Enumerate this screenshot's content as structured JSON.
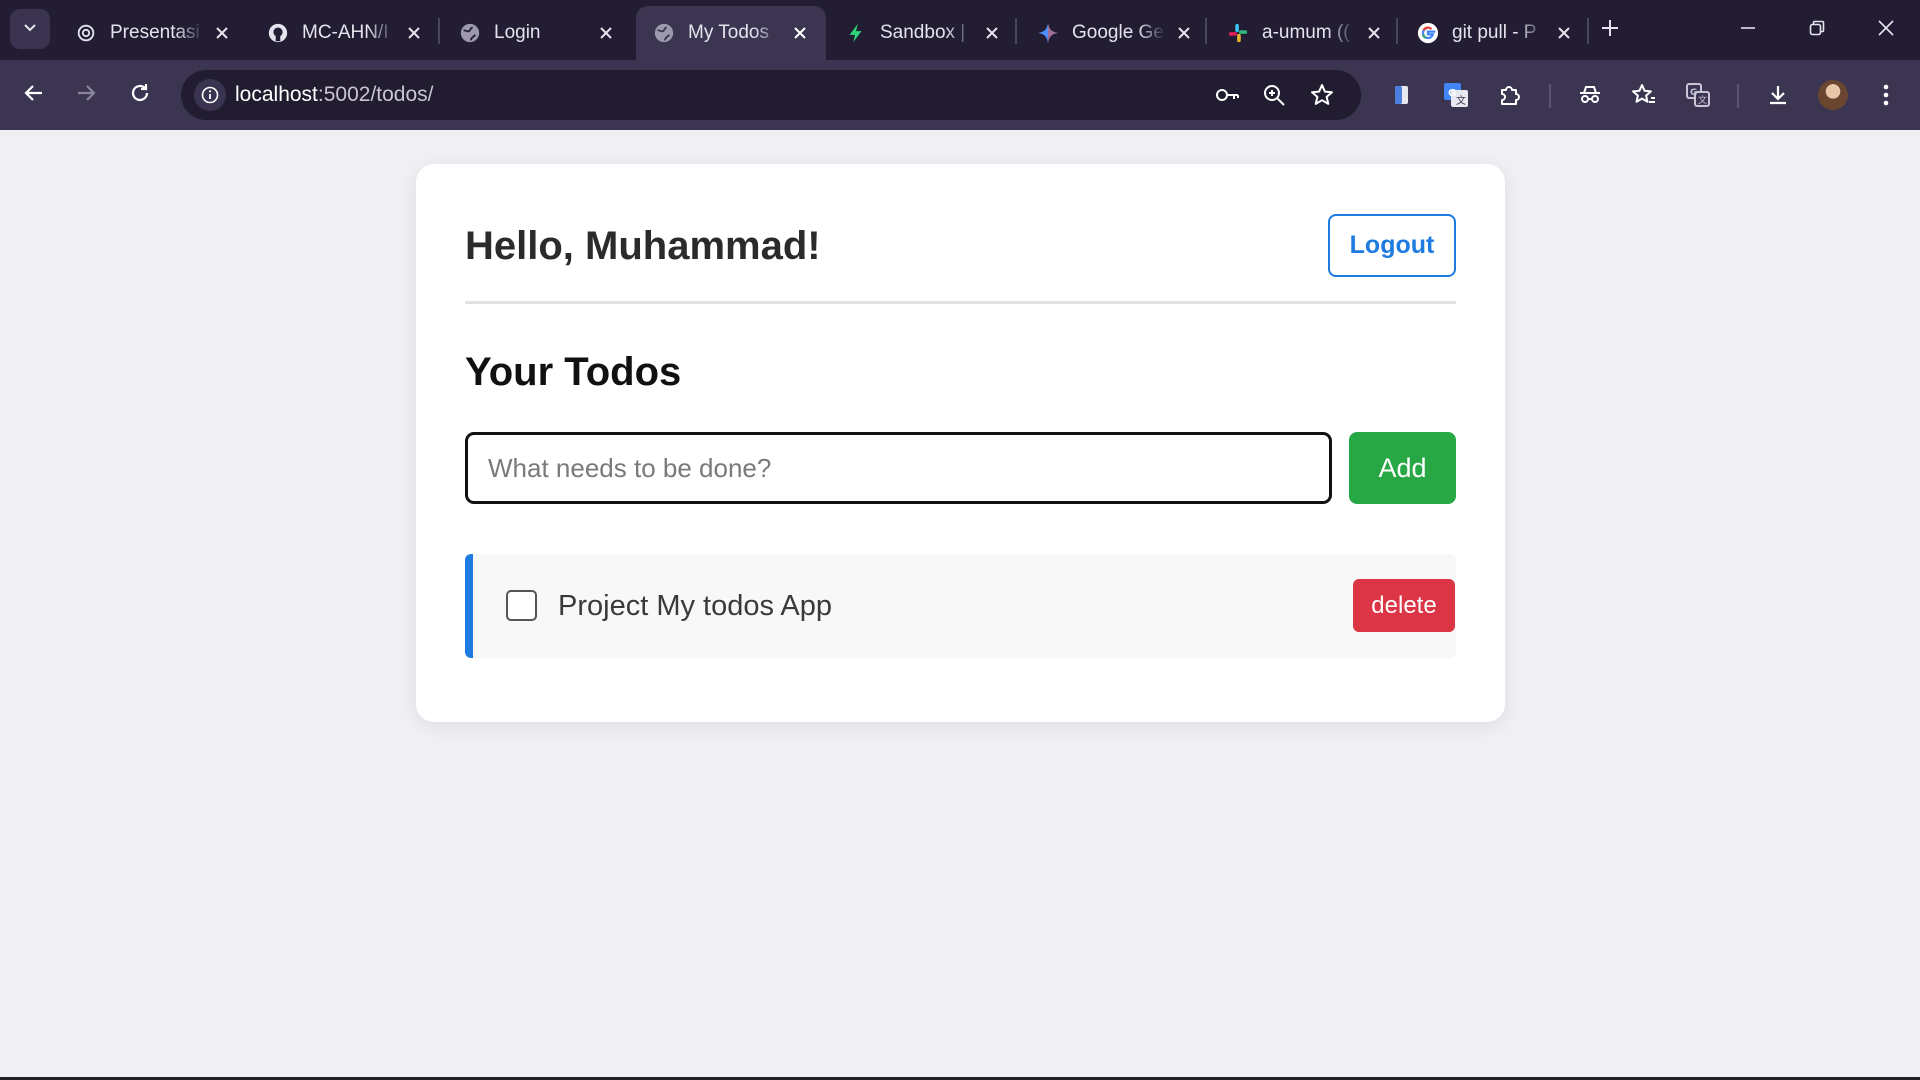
{
  "browser": {
    "tabs": [
      {
        "title": "Presentasi",
        "icon": "openai-icon"
      },
      {
        "title": "MC-AHN/I",
        "icon": "github-icon"
      },
      {
        "title": "Login",
        "icon": "globe-icon"
      },
      {
        "title": "My Todos",
        "icon": "globe-icon",
        "active": true
      },
      {
        "title": "Sandbox | ",
        "icon": "bolt-icon"
      },
      {
        "title": "Google Ge",
        "icon": "gemini-icon"
      },
      {
        "title": "a-umum ((",
        "icon": "slack-icon"
      },
      {
        "title": "git pull - P",
        "icon": "google-icon"
      }
    ],
    "url_host": "localhost",
    "url_path": ":5002/todos/",
    "colors": {
      "tabstrip": "#221d32",
      "toolbar": "#3b3552",
      "omnibox": "#211c30"
    }
  },
  "page": {
    "greeting": "Hello, Muhammad!",
    "logout_label": "Logout",
    "section_title": "Your Todos",
    "input_placeholder": "What needs to be done?",
    "input_value": "",
    "add_label": "Add",
    "todos": [
      {
        "text": "Project My todos App",
        "done": false,
        "delete_label": "delete"
      }
    ],
    "colors": {
      "primary": "#1e7be0",
      "add": "#28a745",
      "delete": "#dc3545",
      "background": "#f0f0f4"
    }
  }
}
